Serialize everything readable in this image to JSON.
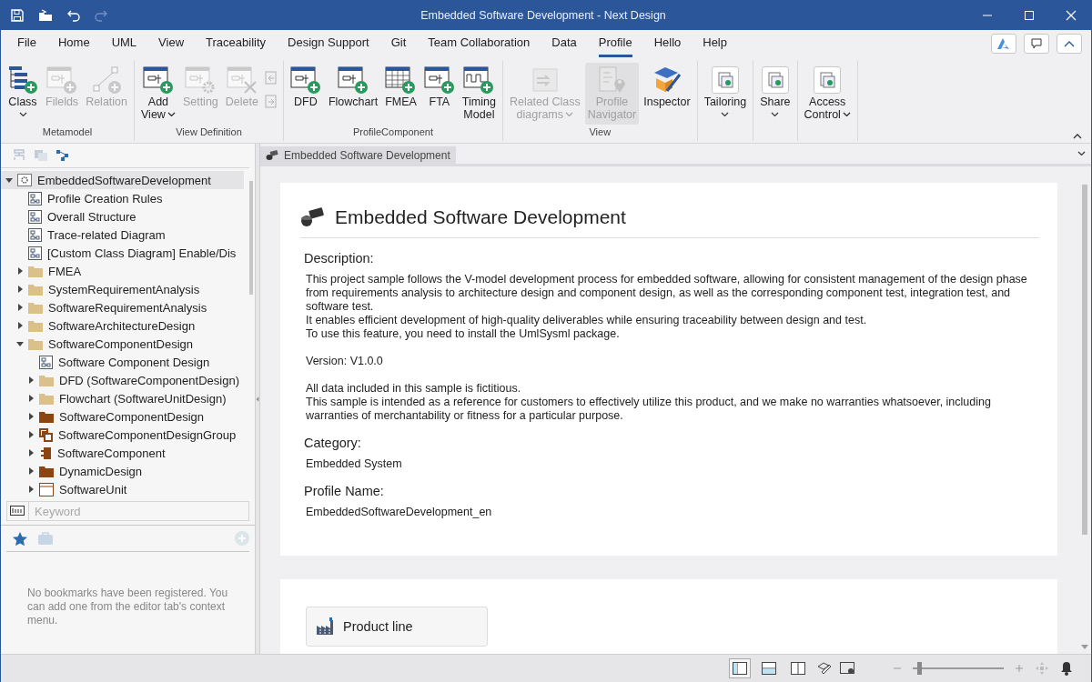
{
  "window": {
    "title": "Embedded Software Development - Next Design"
  },
  "menu_tabs": [
    {
      "label": "File",
      "selected": false
    },
    {
      "label": "Home",
      "selected": false
    },
    {
      "label": "UML",
      "selected": false
    },
    {
      "label": "View",
      "selected": false
    },
    {
      "label": "Traceability",
      "selected": false
    },
    {
      "label": "Design Support",
      "selected": false
    },
    {
      "label": "Git",
      "selected": false
    },
    {
      "label": "Team Collaboration",
      "selected": false
    },
    {
      "label": "Data",
      "selected": false
    },
    {
      "label": "Profile",
      "selected": true
    },
    {
      "label": "Hello",
      "selected": false
    },
    {
      "label": "Help",
      "selected": false
    }
  ],
  "ribbon_groups": [
    {
      "label": "Metamodel",
      "buttons": [
        {
          "kind": "tree-add",
          "lines": [
            "Class"
          ],
          "dropdown": true,
          "disabled": false,
          "selected": false
        },
        {
          "kind": "fields-add",
          "lines": [
            "Filelds"
          ],
          "disabled": true,
          "selected": false
        },
        {
          "kind": "relation-add",
          "lines": [
            "Relation"
          ],
          "disabled": true,
          "selected": false
        }
      ]
    },
    {
      "label": "View Definition",
      "buttons": [
        {
          "kind": "view-add",
          "lines": [
            "Add",
            "View"
          ],
          "dropdown": true,
          "disabled": false,
          "selected": false
        },
        {
          "kind": "view-setting",
          "lines": [
            "Setting"
          ],
          "disabled": true,
          "selected": false
        },
        {
          "kind": "view-delete",
          "lines": [
            "Delete"
          ],
          "disabled": true,
          "selected": false
        }
      ],
      "small_buttons": [
        {
          "disabled": true
        },
        {
          "disabled": true
        }
      ]
    },
    {
      "label": "ProfileComponent",
      "buttons": [
        {
          "kind": "view-add",
          "lines": [
            "DFD"
          ],
          "disabled": false,
          "selected": false
        },
        {
          "kind": "view-add",
          "lines": [
            "Flowchart"
          ],
          "disabled": false,
          "selected": false
        },
        {
          "kind": "grid-add",
          "lines": [
            "FMEA"
          ],
          "disabled": false,
          "selected": false
        },
        {
          "kind": "view-add",
          "lines": [
            "FTA"
          ],
          "disabled": false,
          "selected": false
        },
        {
          "kind": "wave-add",
          "lines": [
            "Timing",
            "Model"
          ],
          "disabled": false,
          "selected": false
        }
      ]
    },
    {
      "label": "View",
      "buttons": [
        {
          "kind": "related",
          "lines": [
            "Related Class",
            "diagrams"
          ],
          "dropdown": true,
          "disabled": true,
          "selected": false
        },
        {
          "kind": "navigator",
          "lines": [
            "Profile",
            "Navigator"
          ],
          "disabled": true,
          "selected": true
        },
        {
          "kind": "inspector",
          "lines": [
            "Inspector"
          ],
          "disabled": false,
          "selected": false
        }
      ]
    },
    {
      "buttons": [
        {
          "kind": "boxed",
          "lines": [
            "Tailoring"
          ],
          "dropdown": true,
          "disabled": false,
          "selected": false
        }
      ]
    },
    {
      "buttons": [
        {
          "kind": "boxed",
          "lines": [
            "Share"
          ],
          "dropdown": true,
          "disabled": false,
          "selected": false
        }
      ]
    },
    {
      "buttons": [
        {
          "kind": "boxed",
          "lines": [
            "Access",
            "Control"
          ],
          "dropdown": true,
          "disabled": false,
          "selected": false
        }
      ]
    }
  ],
  "tree": [
    {
      "kind": "model",
      "label": "EmbeddedSoftwareDevelopment",
      "selected": true,
      "expanded": true,
      "children": [
        {
          "kind": "diagram",
          "label": "Profile Creation Rules",
          "selected": false
        },
        {
          "kind": "diagram",
          "label": "Overall Structure",
          "selected": false
        },
        {
          "kind": "diagram",
          "label": "Trace-related Diagram",
          "selected": false
        },
        {
          "kind": "diagram",
          "label": "[Custom Class Diagram] Enable/Dis",
          "selected": false
        },
        {
          "kind": "folder",
          "label": "FMEA",
          "selected": false,
          "expanded": false
        },
        {
          "kind": "folder",
          "label": "SystemRequirementAnalysis",
          "selected": false,
          "expanded": false
        },
        {
          "kind": "folder",
          "label": "SoftwareRequirementAnalysis",
          "selected": false,
          "expanded": false
        },
        {
          "kind": "folder",
          "label": "SoftwareArchitectureDesign",
          "selected": false,
          "expanded": false
        },
        {
          "kind": "folder",
          "label": "SoftwareComponentDesign",
          "selected": false,
          "expanded": true,
          "children": [
            {
              "kind": "diagram",
              "label": "Software Component Design",
              "selected": false
            },
            {
              "kind": "folder",
              "label": "DFD (SoftwareComponentDesign)",
              "selected": false,
              "expanded": false
            },
            {
              "kind": "folder",
              "label": "Flowchart (SoftwareUnitDesign)",
              "selected": false,
              "expanded": false
            },
            {
              "kind": "package",
              "label": "SoftwareComponentDesign",
              "selected": false,
              "expanded": false
            },
            {
              "kind": "group",
              "label": "SoftwareComponentDesignGroup",
              "selected": false,
              "expanded": false
            },
            {
              "kind": "component",
              "label": "SoftwareComponent",
              "selected": false,
              "expanded": false
            },
            {
              "kind": "package",
              "label": "DynamicDesign",
              "selected": false,
              "expanded": false
            },
            {
              "kind": "unit",
              "label": "SoftwareUnit",
              "selected": false,
              "expanded": false
            }
          ]
        }
      ]
    }
  ],
  "search": {
    "placeholder": "Keyword"
  },
  "bookmark_tabs": [
    {
      "kind": "star",
      "selected": true
    },
    {
      "kind": "toolbox",
      "selected": false
    }
  ],
  "bookmarks_message": "No bookmarks have been registered. You can add one from the editor tab's context menu.",
  "editor_tab": {
    "title": "Embedded Software Development"
  },
  "document": {
    "heading": "Embedded Software Development",
    "sections": [
      {
        "label": "Description:",
        "blocks": [
          [
            "This project sample follows the V-model development process for embedded software, allowing for consistent management of the design phase from requirements analysis to architecture design and component design, as well as the corresponding component test, integration test, and software test.",
            "It enables efficient development of high-quality deliverables while ensuring traceability between design and test.",
            "To use this feature, you need to install the UmlSysml package."
          ],
          [
            "Version: V1.0.0"
          ],
          [
            "All data included in this sample is fictitious.",
            "This sample is intended as a reference for customers to effectively utilize this product, and we make no warranties whatsoever, including warranties of merchantability or fitness for a particular purpose."
          ]
        ]
      },
      {
        "label": "Category:",
        "blocks": [
          [
            "Embedded System"
          ]
        ]
      },
      {
        "label": "Profile Name:",
        "blocks": [
          [
            "EmbeddedSoftwareDevelopment_en"
          ]
        ]
      }
    ],
    "product_button": "Product line"
  },
  "status_bar": {
    "layouts": [
      {
        "selected": true
      },
      {
        "selected": false
      },
      {
        "selected": false
      }
    ],
    "zoom": {
      "level": 0.05
    }
  }
}
